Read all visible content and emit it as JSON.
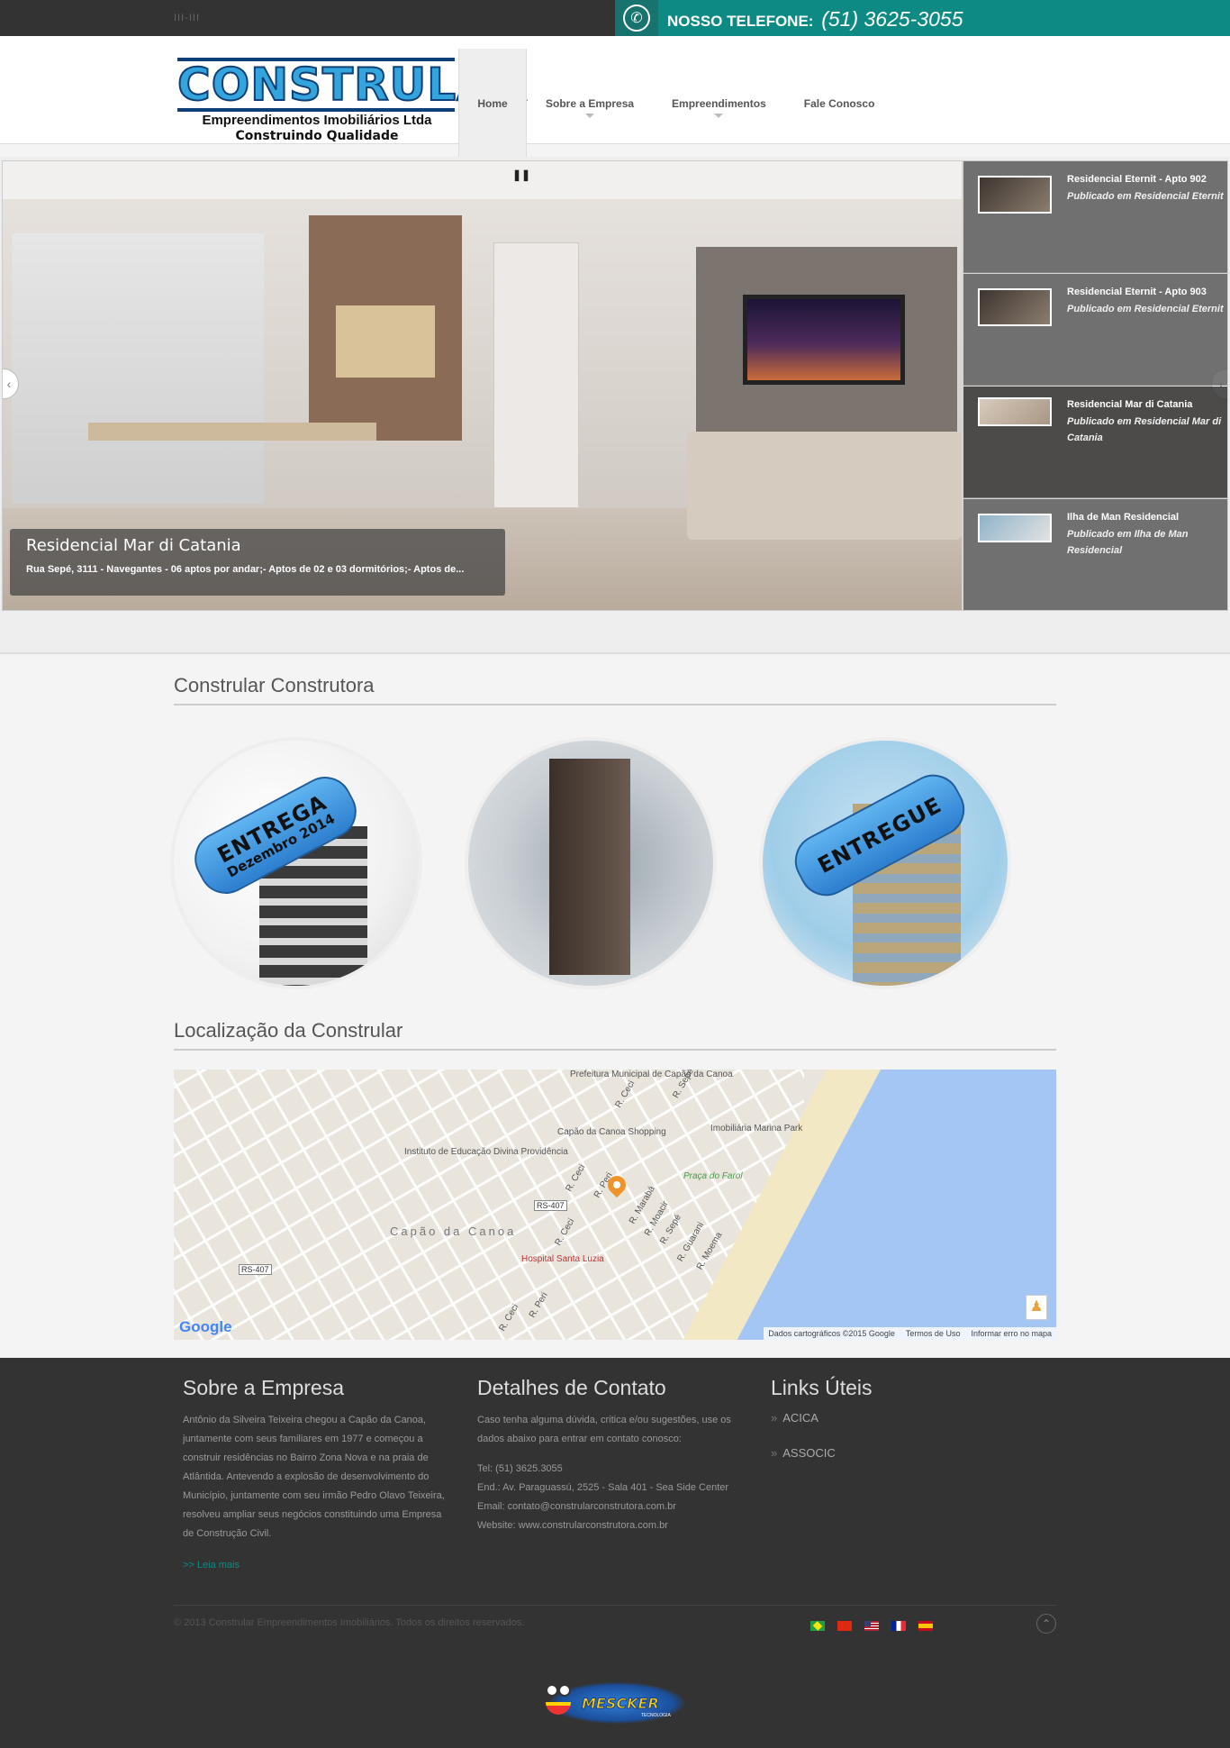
{
  "topbar": {
    "decoration": "III-III",
    "phone_label": "NOSSO TELEFONE:",
    "phone_number": "(51) 3625-3055"
  },
  "logo": {
    "name": "CONSTRULAR",
    "subtitle": "Empreendimentos Imobiliários Ltda",
    "tagline": "Construindo Qualidade"
  },
  "nav": {
    "items": [
      {
        "label": "Home",
        "active": true
      },
      {
        "label": "Sobre a Empresa",
        "has_submenu": true
      },
      {
        "label": "Empreendimentos",
        "has_submenu": true
      },
      {
        "label": "Fale Conosco"
      }
    ]
  },
  "slider": {
    "pause_icon": "pause-icon",
    "caption_title": "Residencial Mar di Catania",
    "caption_desc": "Rua Sepé, 3111 - Navegantes - 06 aptos por andar;- Aptos de 02 e 03 dormitórios;- Aptos de...",
    "thumbs": [
      {
        "title": "Residencial Eternit - Apto 902",
        "subtitle": "Publicado em Residencial Eternit"
      },
      {
        "title": "Residencial Eternit - Apto 903",
        "subtitle": "Publicado em Residencial Eternit"
      },
      {
        "title": "Residencial Mar di Catania",
        "subtitle": "Publicado em Residencial Mar di Catania",
        "active": true
      },
      {
        "title": "Ilha de Man Residencial",
        "subtitle": "Publicado em Ilha de Man Residencial"
      }
    ]
  },
  "section1": {
    "title": "Constrular Construtora",
    "badge1_main": "ENTREGA",
    "badge1_sub": "Dezembro 2014",
    "badge3_main": "ENTREGUE"
  },
  "section2": {
    "title": "Localização da Constrular"
  },
  "map": {
    "labels": {
      "prefeitura": "Prefeitura Municipal de Capão da Canoa",
      "shopping": "Capão da Canoa Shopping",
      "imobiliaria": "Imobiliária Marina Park",
      "instituto": "Instituto de Educação Divina Providência",
      "praca": "Praça do Farol",
      "cidade": "Capão da Canoa",
      "hospital": "Hospital Santa Luzia",
      "rs407a": "RS-407",
      "rs407b": "RS-407",
      "ceci1": "R. Ceci",
      "ceci2": "R. Ceci",
      "ceci3": "R. Ceci",
      "ceci4": "R. Ceci",
      "peri1": "R. Peri",
      "peri2": "R. Peri",
      "maraba": "R. Marabá",
      "moacir": "R. Moacir",
      "sepe1": "R. Sepé",
      "sepe2": "R. Sepé",
      "guarani": "R. Guarani",
      "moema": "R. Moema"
    },
    "google": "Google",
    "footer": [
      "Dados cartográficos ©2015 Google",
      "Termos de Uso",
      "Informar erro no mapa"
    ]
  },
  "footer": {
    "about_title": "Sobre a Empresa",
    "about_text": "Antônio da Silveira Teixeira chegou a Capão da Canoa, juntamente com seus familiares em 1977 e começou a construir residências no Bairro Zona Nova e na praia de Atlântida. Antevendo a explosão de desenvolvimento do Município, juntamente com seu irmão Pedro Olavo Teixeira, resolveu ampliar seus negócios constituindo uma Empresa de Construção Civil.",
    "about_more": ">> Leia mais",
    "contact_title": "Detalhes de Contato",
    "contact_intro": "Caso tenha alguma dúvida, critica e/ou sugestões, use os dados abaixo para entrar em contato conosco:",
    "contact_tel": "Tel: (51) 3625.3055",
    "contact_addr": "End.: Av. Paraguassú, 2525 - Sala 401 - Sea Side Center",
    "contact_email": "Email: contato@constrularconstrutora.com.br",
    "contact_site": "Website: www.constrularconstrutora.com.br",
    "links_title": "Links Úteis",
    "links": [
      "ACICA",
      "ASSOCIC"
    ],
    "copyright": "© 2013 Constrular Empreendimentos Imobiliários. Todos os direitos reservados.",
    "flags": [
      "brazil-flag-icon",
      "china-flag-icon",
      "usa-flag-icon",
      "france-flag-icon",
      "spain-flag-icon"
    ],
    "mescker": "MESCKER",
    "mescker_sub": "TECNOLOGIA"
  },
  "colors": {
    "teal": "#0e8a84",
    "dark": "#333333",
    "logo_blue": "#33a4dc"
  }
}
